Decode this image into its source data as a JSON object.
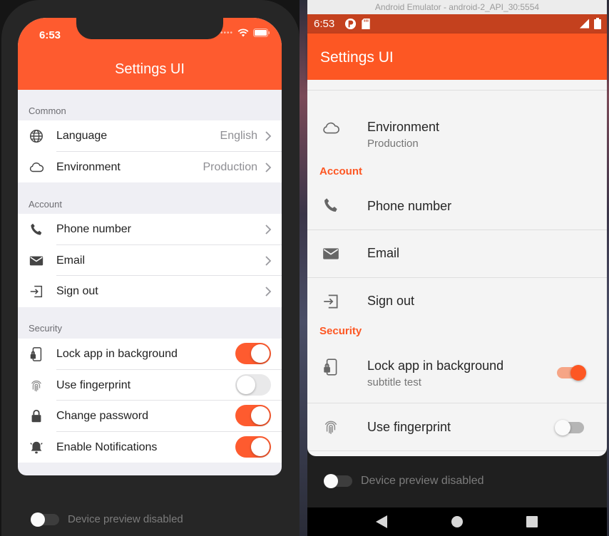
{
  "colors": {
    "accent": "#fe5b2f",
    "android_accent": "#fd5723"
  },
  "ios": {
    "status_time": "6:53",
    "title": "Settings UI",
    "sections": [
      {
        "title": "Common",
        "rows": [
          {
            "icon": "globe-icon",
            "label": "Language",
            "value": "English"
          },
          {
            "icon": "cloud-icon",
            "label": "Environment",
            "value": "Production"
          }
        ]
      },
      {
        "title": "Account",
        "rows": [
          {
            "icon": "phone-icon",
            "label": "Phone number"
          },
          {
            "icon": "mail-icon",
            "label": "Email"
          },
          {
            "icon": "sign-out-icon",
            "label": "Sign out"
          }
        ]
      },
      {
        "title": "Security",
        "rows": [
          {
            "icon": "phone-lock-icon",
            "label": "Lock app in background",
            "toggle": true
          },
          {
            "icon": "fingerprint-icon",
            "label": "Use fingerprint",
            "toggle": false
          },
          {
            "icon": "lock-icon",
            "label": "Change password",
            "toggle": true
          },
          {
            "icon": "bell-icon",
            "label": "Enable Notifications",
            "toggle": true
          }
        ]
      }
    ],
    "device_preview_label": "Device preview disabled",
    "device_preview_on": false
  },
  "android": {
    "window_title": "Android Emulator - android-2_API_30:5554",
    "status_time": "6:53",
    "title": "Settings UI",
    "environment": {
      "label": "Environment",
      "subtitle": "Production"
    },
    "account_title": "Account",
    "account_rows": [
      "Phone number",
      "Email",
      "Sign out"
    ],
    "security_title": "Security",
    "lock": {
      "label": "Lock app in background",
      "subtitle": "subtitle test",
      "toggle": true
    },
    "fingerprint": {
      "label": "Use fingerprint",
      "toggle": false
    },
    "device_preview_label": "Device preview disabled",
    "device_preview_on": false
  }
}
